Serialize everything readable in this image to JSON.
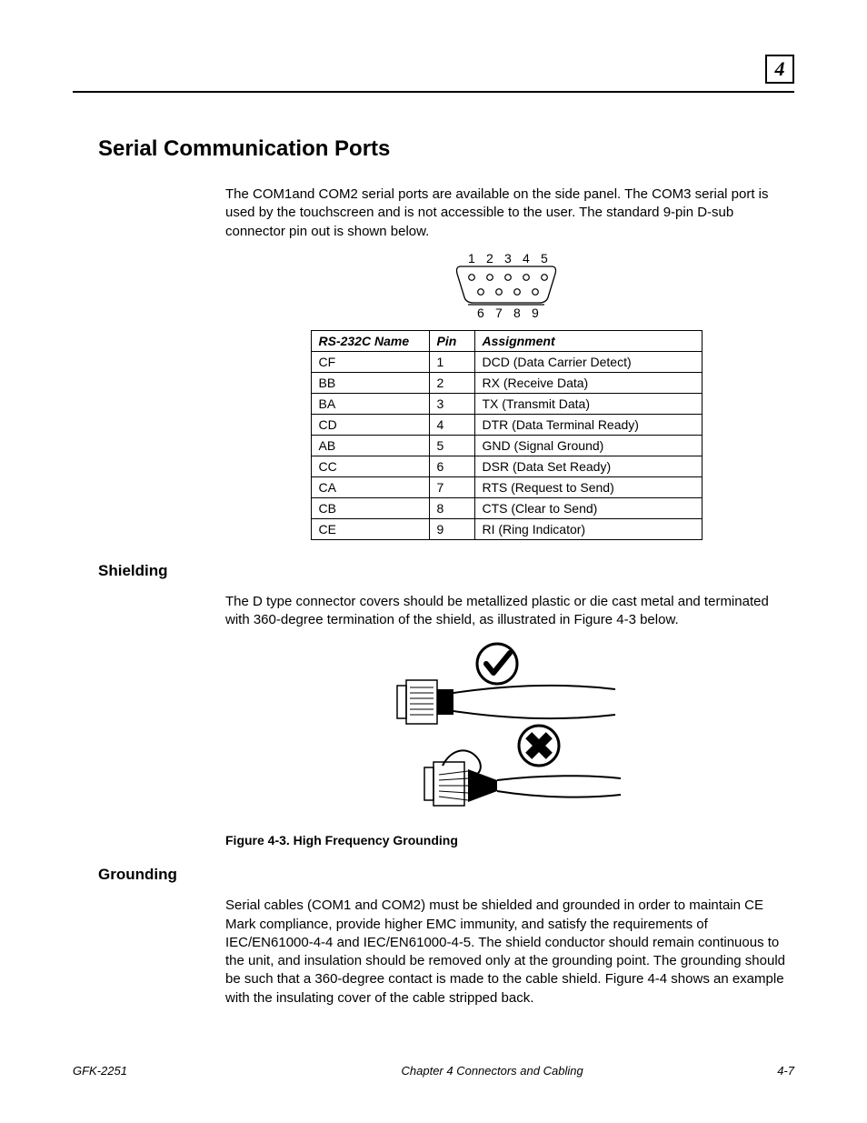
{
  "page_marker": "4",
  "section_title": "Serial Communication Ports",
  "intro_para": "The COM1and COM2 serial ports are available on the side panel. The COM3 serial port is used by the touchscreen and is not accessible to the user. The standard 9-pin D-sub connector pin out is shown below.",
  "connector": {
    "top_labels": [
      "1",
      "2",
      "3",
      "4",
      "5"
    ],
    "bottom_labels": [
      "6",
      "7",
      "8",
      "9"
    ]
  },
  "table": {
    "headers": {
      "name": "RS-232C Name",
      "pin": "Pin",
      "assign": "Assignment"
    },
    "rows": [
      {
        "name": "CF",
        "pin": "1",
        "assign": "DCD (Data Carrier Detect)"
      },
      {
        "name": "BB",
        "pin": "2",
        "assign": "RX (Receive Data)"
      },
      {
        "name": "BA",
        "pin": "3",
        "assign": "TX (Transmit Data)"
      },
      {
        "name": "CD",
        "pin": "4",
        "assign": "DTR (Data Terminal Ready)"
      },
      {
        "name": "AB",
        "pin": "5",
        "assign": "GND (Signal Ground)"
      },
      {
        "name": "CC",
        "pin": "6",
        "assign": "DSR (Data Set Ready)"
      },
      {
        "name": "CA",
        "pin": "7",
        "assign": "RTS (Request to Send)"
      },
      {
        "name": "CB",
        "pin": "8",
        "assign": "CTS (Clear to Send)"
      },
      {
        "name": "CE",
        "pin": "9",
        "assign": "RI (Ring Indicator)"
      }
    ]
  },
  "shielding": {
    "title": "Shielding",
    "para": "The D type connector covers should be metallized plastic or die cast metal and terminated with 360-degree termination of the shield, as illustrated in Figure 4-3 below.",
    "caption": "Figure 4-3. High Frequency Grounding"
  },
  "grounding": {
    "title": "Grounding",
    "para": "Serial cables (COM1 and COM2) must be shielded and grounded in order to maintain CE Mark compliance, provide higher EMC immunity, and satisfy the requirements of IEC/EN61000-4-4 and IEC/EN61000-4-5. The shield conductor should remain continuous to the unit, and insulation should be removed only at the grounding point. The grounding should be such that a 360-degree contact is made to the cable shield. Figure 4-4 shows an example with the insulating cover of the cable stripped back."
  },
  "footer": {
    "doc": "GFK-2251",
    "chapter": "Chapter 4   Connectors and Cabling",
    "page": "4-7"
  }
}
